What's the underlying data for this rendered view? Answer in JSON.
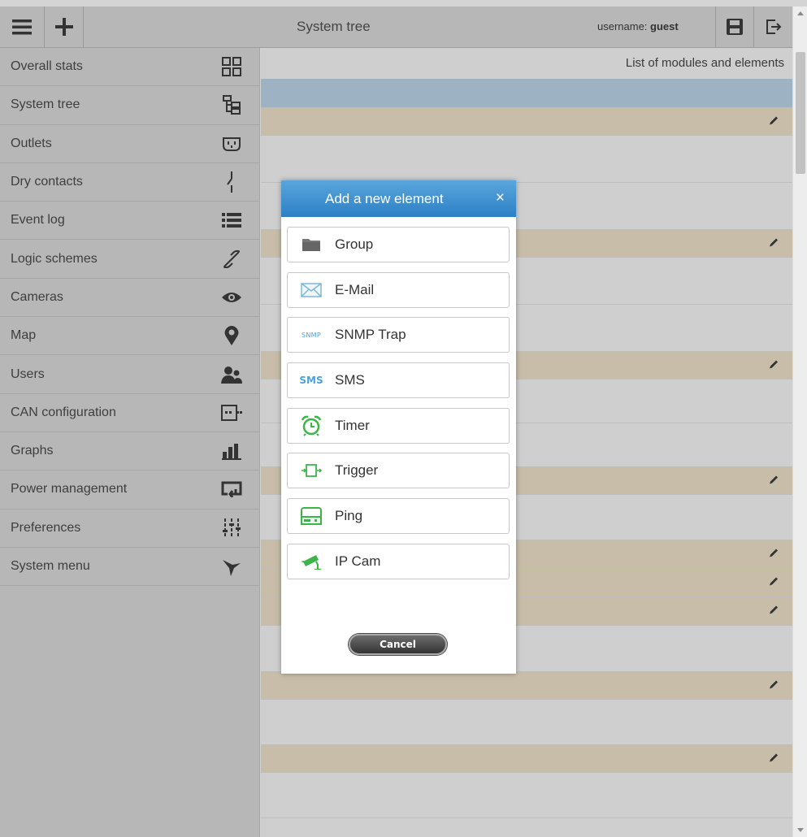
{
  "topbar": {
    "title": "System tree",
    "username_label": "username:",
    "username_value": "guest",
    "menu_icon": "hamburger-icon",
    "add_icon": "plus-icon",
    "save_icon": "floppy-disk-icon",
    "logout_icon": "logout-icon"
  },
  "sidebar": {
    "items": [
      {
        "label": "Overall stats",
        "icon": "grid-icon"
      },
      {
        "label": "System tree",
        "icon": "tree-icon"
      },
      {
        "label": "Outlets",
        "icon": "outlet-icon"
      },
      {
        "label": "Dry contacts",
        "icon": "switch-contact-icon"
      },
      {
        "label": "Event log",
        "icon": "list-icon"
      },
      {
        "label": "Logic schemes",
        "icon": "link-icon"
      },
      {
        "label": "Cameras",
        "icon": "eye-icon"
      },
      {
        "label": "Map",
        "icon": "map-pin-icon"
      },
      {
        "label": "Users",
        "icon": "users-icon"
      },
      {
        "label": "CAN configuration",
        "icon": "can-bus-icon"
      },
      {
        "label": "Graphs",
        "icon": "bar-chart-icon"
      },
      {
        "label": "Power management",
        "icon": "power-management-icon"
      },
      {
        "label": "Preferences",
        "icon": "sliders-icon"
      },
      {
        "label": "System menu",
        "icon": "bird-icon"
      }
    ]
  },
  "content": {
    "header": "List of modules and elements"
  },
  "modal": {
    "title": "Add a new element",
    "close_symbol": "×",
    "buttons": [
      {
        "label": "Group",
        "icon": "folder-icon"
      },
      {
        "label": "E-Mail",
        "icon": "envelope-icon"
      },
      {
        "label": "SNMP Trap",
        "icon": "snmp-icon",
        "icon_text": "SNMP"
      },
      {
        "label": "SMS",
        "icon": "sms-icon",
        "icon_text": "SMS"
      },
      {
        "label": "Timer",
        "icon": "alarm-clock-icon"
      },
      {
        "label": "Trigger",
        "icon": "trigger-icon"
      },
      {
        "label": "Ping",
        "icon": "ping-device-icon"
      },
      {
        "label": "IP Cam",
        "icon": "security-camera-icon"
      }
    ],
    "cancel_label": "Cancel"
  },
  "colors": {
    "modal_header": "#2b80c4",
    "row_blue": "#9db3c4",
    "row_tan": "#c8bda8",
    "sidebar": "#b7b7b7"
  }
}
